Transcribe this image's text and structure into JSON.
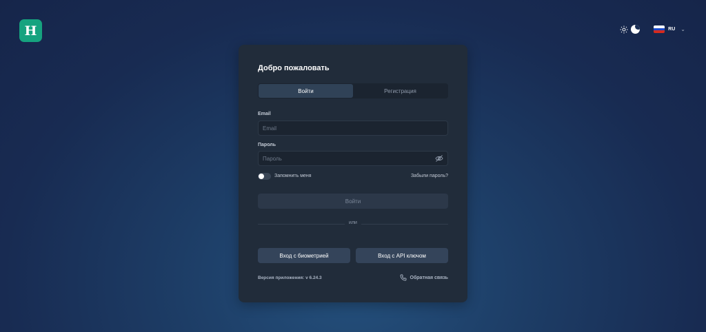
{
  "app": {
    "logo_letter": "H"
  },
  "header": {
    "theme_icons": [
      "sun-icon",
      "moon-icon"
    ],
    "language": {
      "code": "RU",
      "flag": "russia-flag-icon"
    }
  },
  "login": {
    "title": "Добро пожаловать",
    "tabs": [
      {
        "label": "Войти",
        "active": true
      },
      {
        "label": "Регистрация",
        "active": false
      }
    ],
    "email": {
      "label": "Email",
      "placeholder": "Email",
      "value": ""
    },
    "password": {
      "label": "Пароль",
      "placeholder": "Пароль",
      "value": ""
    },
    "remember_label": "Запомнить меня",
    "remember_checked": false,
    "forgot_label": "Забыли пароль?",
    "submit_label": "Войти",
    "divider_text": "или",
    "biometric_label": "Вход с биометрией",
    "api_key_label": "Вход с API ключом",
    "version_text": "Версия приложения: v 6.24.3",
    "feedback_label": "Обратная связь"
  },
  "colors": {
    "brand": "#16a37f",
    "card_bg": "#212c3a",
    "accent_button": "#34445a"
  }
}
